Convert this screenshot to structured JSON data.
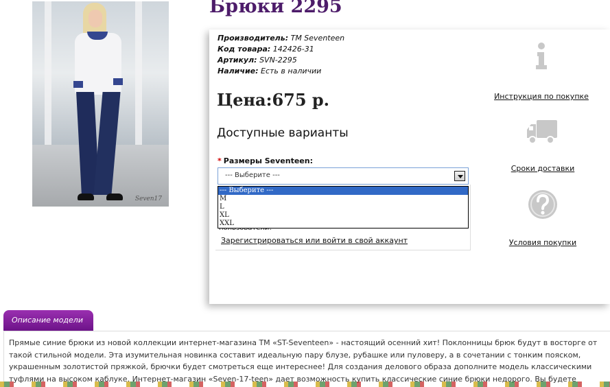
{
  "product": {
    "title": "Брюки 2295",
    "photo_watermark": "Seven17",
    "meta": {
      "manufacturer_label": "Производитель:",
      "manufacturer_value": "ТМ Seventeen",
      "code_label": "Код товара:",
      "code_value": "142426-31",
      "article_label": "Артикул:",
      "article_value": "SVN-2295",
      "availability_label": "Наличие:",
      "availability_value": "Есть в наличии"
    },
    "price": "Цена:675 р.",
    "variants_heading": "Доступные варианты",
    "size": {
      "required_mark": "*",
      "label": "Размеры Seventeen:",
      "selected": "--- Выберите ---",
      "options": [
        "--- Выберите ---",
        "M",
        "L",
        "XL",
        "XXL"
      ]
    },
    "hidden_message": "пользователи!",
    "register_link": "Зарегистрироваться или войти в свой аккаунт"
  },
  "sidebar_info": [
    {
      "icon": "info-icon",
      "label": "Инструкция по покупке"
    },
    {
      "icon": "truck-icon",
      "label": "Сроки доставки"
    },
    {
      "icon": "question-icon",
      "label": "Условия покупки"
    }
  ],
  "description": {
    "tab_label": "Описание модели",
    "text": "Прямые синие брюки из новой коллекции интернет-магазина ТМ «ST-Seventeen» - настоящий осенний хит! Поклонницы брюк будут в восторге от такой стильной модели. Эта изумительная новинка составит идеальную пару блузе, рубашке или пуловеру, а в сочетании с тонким пояском, украшенным золотистой пряжкой, брючки будет смотреться еще интереснее! Для создания делового образа дополните модель классическими туфлями на высоком каблуке. Интернет-магазин «Seven-17-teen» дает возможность купить классические синие брюки недорого. Вы будете приятно удивлены быстрой доставкой"
  },
  "colors": {
    "title": "#4d1c6a",
    "tab": "#7e1d9c",
    "selected_option": "#3169c6",
    "icon_gray": "#c8c8c8"
  }
}
